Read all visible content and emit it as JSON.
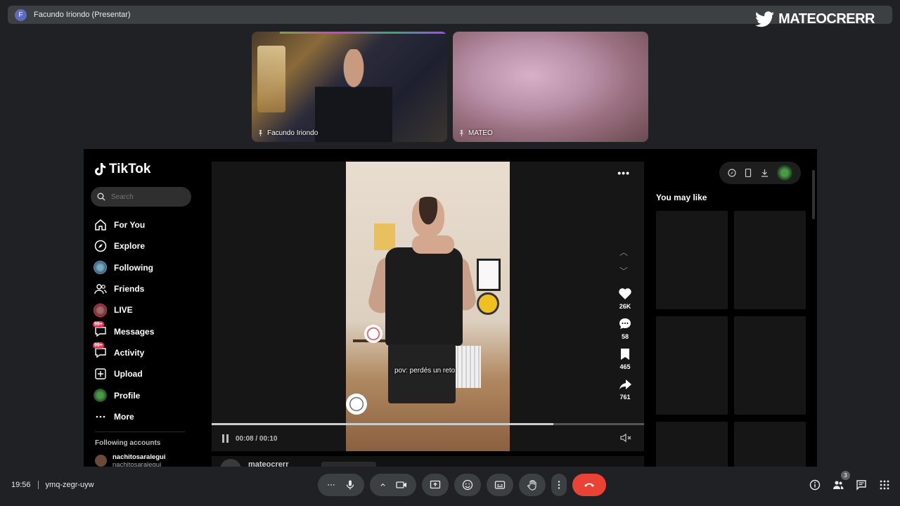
{
  "presenter": {
    "avatar_letter": "F",
    "label": "Facundo Iriondo (Presentar)"
  },
  "watermark": {
    "icon": "twitter-icon",
    "text": "MATEOCRERR"
  },
  "participants": [
    {
      "name": "Facundo Iriondo",
      "icon": "pin-icon"
    },
    {
      "name": "MATEO",
      "icon": "pin-icon"
    }
  ],
  "tiktok": {
    "brand": "TikTok",
    "search": {
      "placeholder": "Search"
    },
    "nav": [
      {
        "label": "For You",
        "icon": "home-icon"
      },
      {
        "label": "Explore",
        "icon": "compass-icon"
      },
      {
        "label": "Following",
        "icon": "following-avatar"
      },
      {
        "label": "Friends",
        "icon": "friends-icon"
      },
      {
        "label": "LIVE",
        "icon": "live-avatar"
      },
      {
        "label": "Messages",
        "icon": "messages-icon",
        "badge": "99+"
      },
      {
        "label": "Activity",
        "icon": "activity-icon",
        "badge": "99+"
      },
      {
        "label": "Upload",
        "icon": "upload-icon"
      },
      {
        "label": "Profile",
        "icon": "profile-avatar"
      },
      {
        "label": "More",
        "icon": "more-icon"
      }
    ],
    "following_accounts": {
      "title": "Following accounts",
      "accounts": [
        {
          "name": "nachitosaralegui",
          "handle": "nachitosaralegui"
        }
      ]
    },
    "video": {
      "caption": "pov: perdés un reto",
      "time": "00:08 / 00:10",
      "progress": 0.79,
      "author": "mateocrerr",
      "actions": [
        {
          "icon": "heart-icon",
          "count": "26K"
        },
        {
          "icon": "comment-icon",
          "count": "58"
        },
        {
          "icon": "bookmark-icon",
          "count": "465"
        },
        {
          "icon": "share-icon",
          "count": "761"
        }
      ]
    },
    "right_panel": {
      "title": "You may like"
    }
  },
  "meet": {
    "time": "19:56",
    "meeting_code": "ymq-zegr-uyw",
    "participant_count": "3",
    "colors": {
      "end_call": "#ea4335",
      "background": "#202124",
      "button": "#3c4043"
    }
  }
}
